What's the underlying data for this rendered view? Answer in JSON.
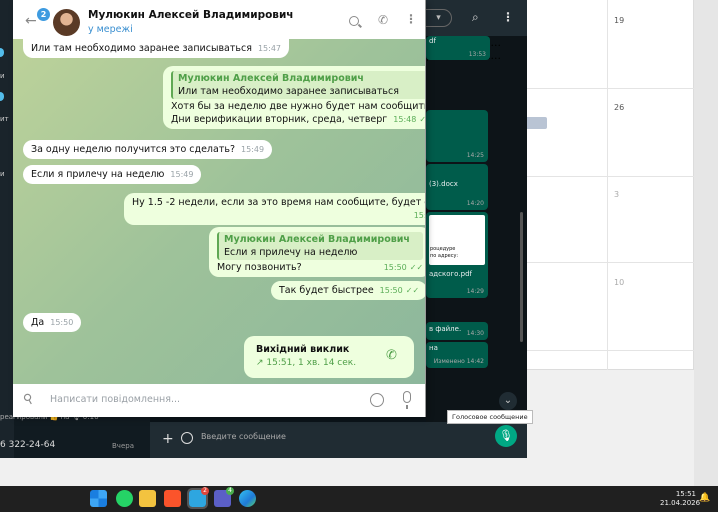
{
  "telegram": {
    "unread_badge": "2",
    "contact_name": "Мулюкин Алексей Владимирович",
    "status": "у мережі",
    "messages": [
      {
        "text": "Или там необходимо заранее записываться",
        "time": "15:47"
      },
      {
        "quote_name": "Мулюкин Алексей Владимирович",
        "quote_text": "Или там необходимо заранее записываться",
        "line1": "Хотя бы за неделю две нужно будет нам сообщить",
        "line2": "Дни верификации вторник, среда, четверг",
        "time": "15:48"
      },
      {
        "text": "За одну неделю получится это сделать?",
        "time": "15:49"
      },
      {
        "text": "Если я прилечу на неделю",
        "time": "15:49"
      },
      {
        "text": "Ну 1.5 -2 недели, если за это время нам сообщите, будет супер",
        "time": "15:49"
      },
      {
        "quote_name": "Мулюкин Алексей Владимирович",
        "quote_text": "Если я прилечу на неделю",
        "line1": "Могу позвонить?",
        "time": "15:50"
      },
      {
        "text": "Так будет быстрее",
        "time": "15:50"
      },
      {
        "text": "Да",
        "time": "15:50"
      }
    ],
    "call": {
      "title": "Вихідний виклик",
      "detail": "↗ 15:51, 1 хв. 14 сек."
    },
    "input_placeholder": "Написати повідомлення..."
  },
  "whatsapp": {
    "sidebar_labels": [
      "и",
      "ит",
      "и"
    ],
    "header_dropdown": "▾",
    "file_pdf_label": "df",
    "times": [
      "13:53",
      "14:25",
      "14:20",
      "14:29",
      "14:30",
      "14:42"
    ],
    "save_link": "ранить как...",
    "docx_label": "(3).docx",
    "doc_preview_lines": [
      "роцедуре",
      "по адресу:"
    ],
    "pdf_label": "адского.pdf",
    "file_label": "в файле.",
    "short_label": "на",
    "edited_label": "Изменено 14:42",
    "chat_preview": "реагировали 👍 на  🎙 0:16",
    "phone_preview": "6 322-24-64",
    "preview_date": "Вчера",
    "input_placeholder": "Введите сообщение",
    "voice_tooltip": "Голосовое сообщение"
  },
  "calendar": {
    "days": [
      "19",
      "26",
      "3",
      "10"
    ]
  },
  "taskbar": {
    "time": "15:51",
    "date": "21.04.2026",
    "badges": [
      "2",
      "4"
    ]
  }
}
